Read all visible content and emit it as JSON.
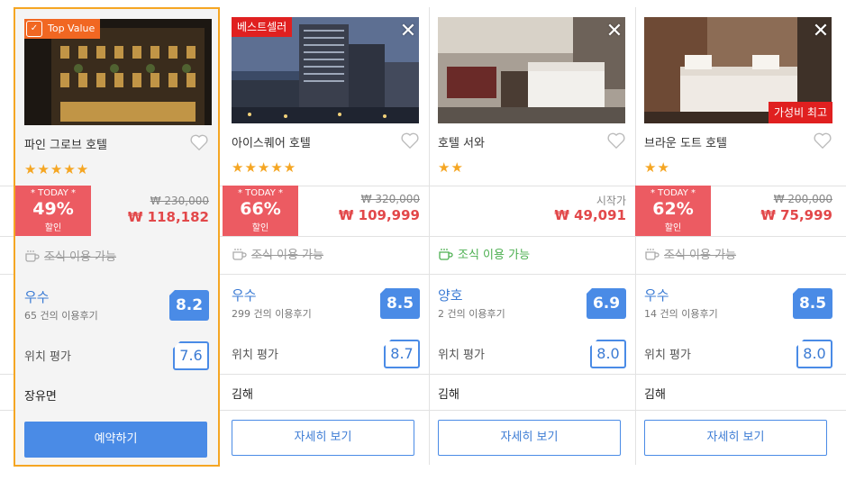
{
  "colors": {
    "accent": "#4a8be6",
    "discount": "#ec5b62",
    "price": "#e2484a",
    "star": "#f5a623",
    "featured_border": "#f5a623",
    "breakfast_on": "#4caf50"
  },
  "cards": [
    {
      "badge": "Top Value",
      "name": "파인 그로브 호텔",
      "stars": "★★★★★",
      "today_label": "* TODAY *",
      "discount": "49%",
      "discount_sub": "할인",
      "original_price": "₩ 230,000",
      "price": "₩ 118,182",
      "breakfast": "조식 이용 가능",
      "grade": "우수",
      "reviews": "65 건의 이용후기",
      "score": "8.2",
      "location_label": "위치 평가",
      "location_score": "7.6",
      "area": "장유면",
      "button": "예약하기"
    },
    {
      "badge": "베스트셀러",
      "name": "아이스퀘어 호텔",
      "stars": "★★★★★",
      "today_label": "* TODAY *",
      "discount": "66%",
      "discount_sub": "할인",
      "original_price": "₩ 320,000",
      "price": "₩ 109,999",
      "breakfast": "조식 이용 가능",
      "grade": "우수",
      "reviews": "299 건의 이용후기",
      "score": "8.5",
      "location_label": "위치 평가",
      "location_score": "8.7",
      "area": "김해",
      "button": "자세히 보기",
      "close": "✕"
    },
    {
      "name": "호텔 서와",
      "stars": "★★",
      "from_label": "시작가",
      "price": "₩ 49,091",
      "breakfast": "조식 이용 가능",
      "grade": "양호",
      "reviews": "2 건의 이용후기",
      "score": "6.9",
      "location_label": "위치 평가",
      "location_score": "8.0",
      "area": "김해",
      "button": "자세히 보기",
      "close": "✕"
    },
    {
      "badge_value": "가성비 최고",
      "name": "브라운 도트 호텔",
      "stars": "★★",
      "today_label": "* TODAY *",
      "discount": "62%",
      "discount_sub": "할인",
      "original_price": "₩ 200,000",
      "price": "₩ 75,999",
      "breakfast": "조식 이용 가능",
      "grade": "우수",
      "reviews": "14 건의 이용후기",
      "score": "8.5",
      "location_label": "위치 평가",
      "location_score": "8.0",
      "area": "김해",
      "button": "자세히 보기",
      "close": "✕"
    }
  ]
}
